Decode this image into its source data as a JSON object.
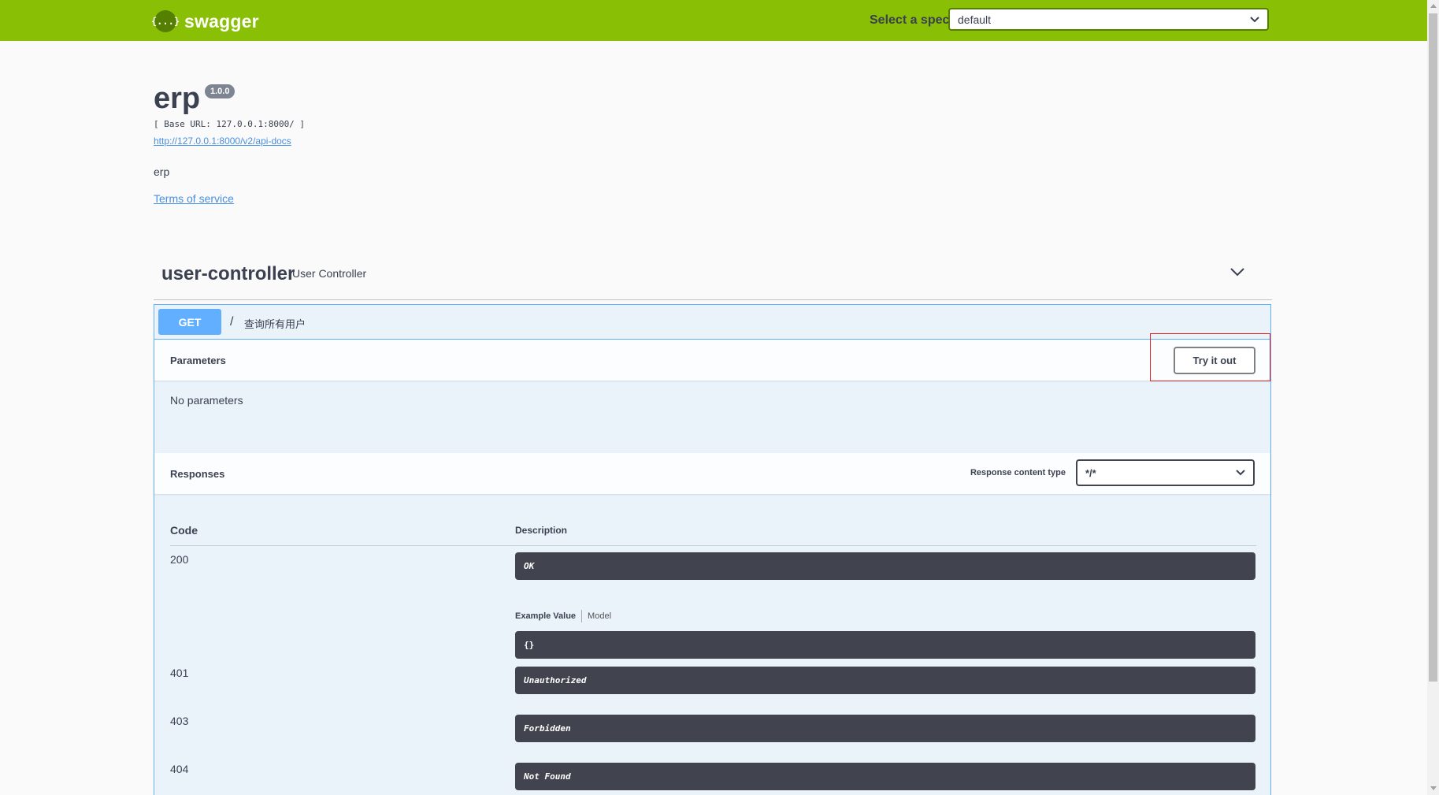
{
  "topbar": {
    "logo_glyph": "{...}",
    "logo_text": "swagger",
    "spec_label": "Select a spec",
    "spec_value": "default"
  },
  "info": {
    "title": "erp",
    "version": "1.0.0",
    "base_url": "[ Base URL: 127.0.0.1:8000/ ]",
    "docs_link": "http://127.0.0.1:8000/v2/api-docs",
    "description": "erp",
    "terms_link": "Terms of service"
  },
  "tag": {
    "name": "user-controller",
    "description": "User Controller"
  },
  "operation": {
    "method": "GET",
    "path": "/",
    "summary": "查询所有用户",
    "parameters_title": "Parameters",
    "try_it_out": "Try it out",
    "no_parameters": "No parameters",
    "responses_title": "Responses",
    "response_content_type_label": "Response content type",
    "response_content_type_value": "*/*",
    "table": {
      "col_code": "Code",
      "col_description": "Description"
    },
    "responses": [
      {
        "code": "200",
        "description": "OK"
      },
      {
        "code": "401",
        "description": "Unauthorized"
      },
      {
        "code": "403",
        "description": "Forbidden"
      },
      {
        "code": "404",
        "description": "Not Found"
      }
    ],
    "example_tab": "Example Value",
    "model_tab": "Model",
    "example_value": "{}"
  },
  "colors": {
    "topbar": "#89bf04",
    "get_method": "#61affe",
    "highlight": "#e02020"
  }
}
